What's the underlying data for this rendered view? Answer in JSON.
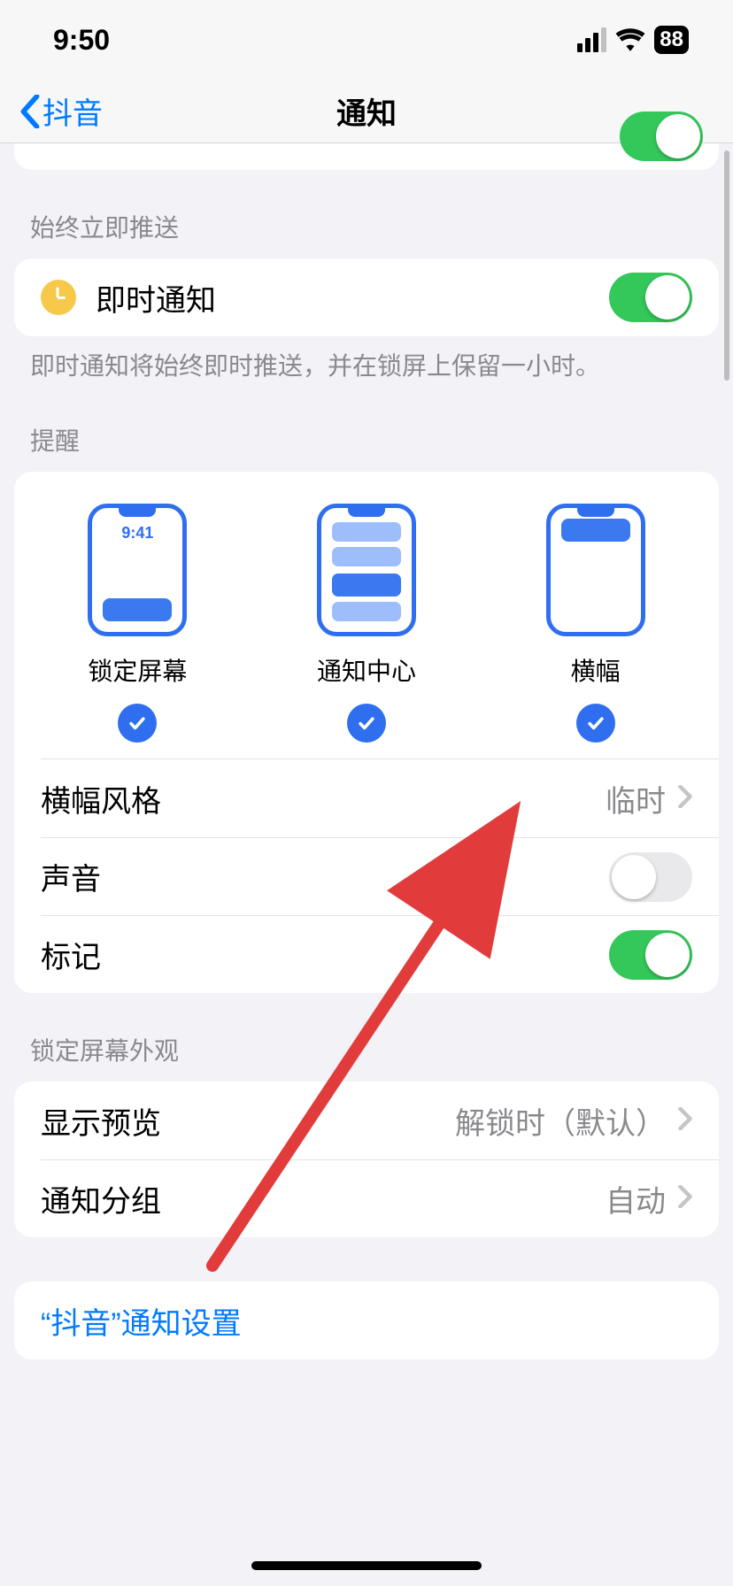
{
  "status": {
    "time": "9:50",
    "battery": "88"
  },
  "nav": {
    "back_label": "抖音",
    "title": "通知"
  },
  "section_instant": {
    "header": "始终立即推送",
    "row_label": "即时通知",
    "footer": "即时通知将始终即时推送，并在锁屏上保留一小时。"
  },
  "section_alerts": {
    "header": "提醒",
    "options": {
      "lock": "锁定屏幕",
      "center": "通知中心",
      "banner": "横幅"
    },
    "preview_time": "9:41",
    "banner_style": {
      "label": "横幅风格",
      "value": "临时"
    },
    "sounds_label": "声音",
    "badges_label": "标记"
  },
  "section_lock_appearance": {
    "header": "锁定屏幕外观",
    "preview": {
      "label": "显示预览",
      "value": "解锁时（默认）"
    },
    "grouping": {
      "label": "通知分组",
      "value": "自动"
    }
  },
  "app_settings_link": "“抖音”通知设置"
}
